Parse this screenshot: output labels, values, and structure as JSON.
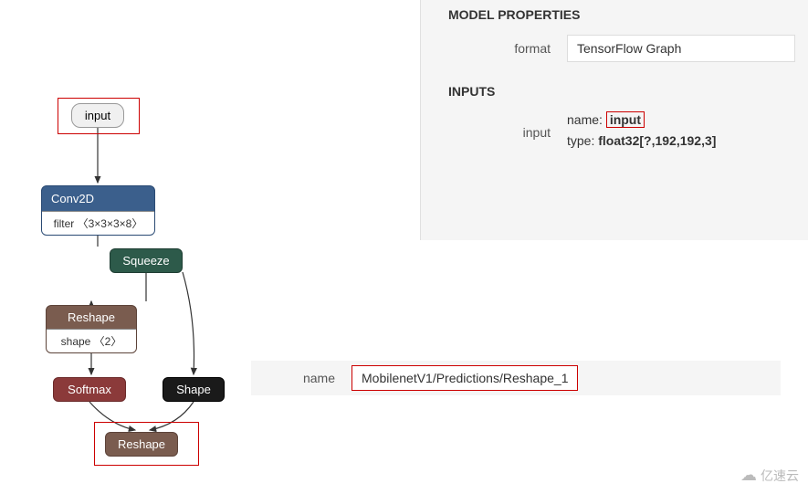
{
  "graph": {
    "input": {
      "label": "input"
    },
    "conv2d": {
      "label": "Conv2D",
      "filter": "filter 〈3×3×3×8〉"
    },
    "squeeze": {
      "label": "Squeeze"
    },
    "reshape1": {
      "label": "Reshape",
      "shape": "shape 〈2〉"
    },
    "softmax": {
      "label": "Softmax"
    },
    "shape": {
      "label": "Shape"
    },
    "reshape2": {
      "label": "Reshape"
    }
  },
  "properties": {
    "section_model": "MODEL PROPERTIES",
    "format_label": "format",
    "format_value": "TensorFlow Graph",
    "section_inputs": "INPUTS",
    "input_label": "input",
    "name_prefix": "name:",
    "name_value": "input",
    "type_prefix": "type:",
    "type_value": "float32[?,192,192,3]"
  },
  "name_panel": {
    "label": "name",
    "value": "MobilenetV1/Predictions/Reshape_1"
  },
  "watermark": {
    "text": "亿速云"
  }
}
